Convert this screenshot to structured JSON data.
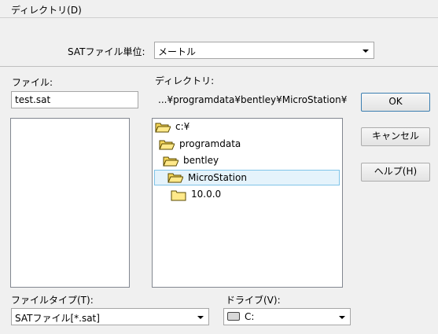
{
  "menu": {
    "directory": "ディレクトリ(D)"
  },
  "sat_unit": {
    "label": "SATファイル単位:",
    "value": "メートル"
  },
  "file": {
    "label": "ファイル:",
    "value": "test.sat"
  },
  "directory": {
    "label": "ディレクトリ:",
    "path": "...¥programdata¥bentley¥MicroStation¥",
    "tree": [
      {
        "label": "c:¥",
        "icon": "open-folder-icon"
      },
      {
        "label": "programdata",
        "icon": "open-folder-icon"
      },
      {
        "label": "bentley",
        "icon": "open-folder-icon"
      },
      {
        "label": "MicroStation",
        "icon": "open-folder-icon",
        "selected": true
      },
      {
        "label": "10.0.0",
        "icon": "closed-folder-icon"
      }
    ]
  },
  "buttons": {
    "ok": "OK",
    "cancel": "キャンセル",
    "help": "ヘルプ(H)"
  },
  "file_type": {
    "label": "ファイルタイプ(T):",
    "value": "SATファイル[*.sat]"
  },
  "drive": {
    "label": "ドライブ(V):",
    "value": "C:"
  },
  "colors": {
    "folder_fill": "#ffe98a",
    "selection": "#e5f3fb",
    "selection_border": "#7fc4e8"
  }
}
